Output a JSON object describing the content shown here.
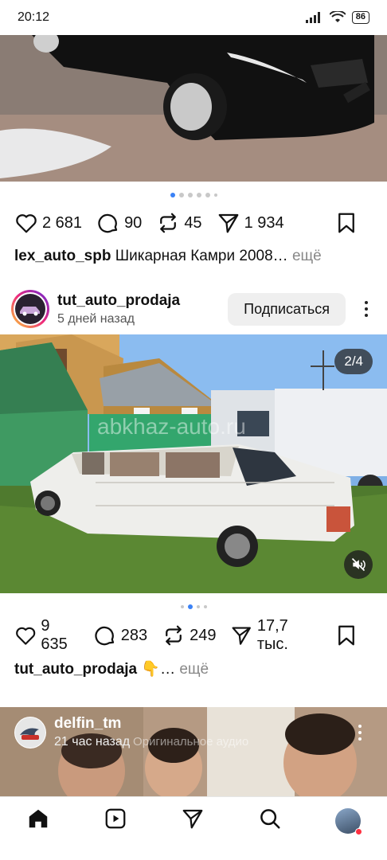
{
  "status_bar": {
    "time": "20:12",
    "battery": "86"
  },
  "post1": {
    "carousel_total": 6,
    "carousel_active": 1,
    "likes": "2 681",
    "comments": "90",
    "reposts": "45",
    "shares": "1 934",
    "caption_user": "lex_auto_spb",
    "caption_text": "Шикарная Камри 2008…",
    "more_label": "ещё"
  },
  "post2": {
    "username": "tut_auto_prodaja",
    "timestamp": "5 дней назад",
    "follow_label": "Подписаться",
    "counter": "2/4",
    "watermark": "abkhaz-auto.ru",
    "carousel_total": 4,
    "carousel_active": 2,
    "likes": "9 635",
    "comments": "283",
    "reposts": "249",
    "shares": "17,7 тыс.",
    "caption_user": "tut_auto_prodaja",
    "caption_text": "👇…",
    "more_label": "ещё"
  },
  "post3": {
    "username": "delfin_tm",
    "timestamp": "21 час назад",
    "audio": "Оригинальное аудио"
  },
  "icons": {
    "like": "heart-icon",
    "comment": "comment-icon",
    "repost": "repost-icon",
    "share": "send-icon",
    "save": "bookmark-icon",
    "home": "home-icon",
    "reels": "reels-icon",
    "direct": "send-icon",
    "search": "search-icon",
    "profile": "avatar"
  },
  "colors": {
    "accent": "#3b82f6",
    "notification": "#ff3040"
  }
}
